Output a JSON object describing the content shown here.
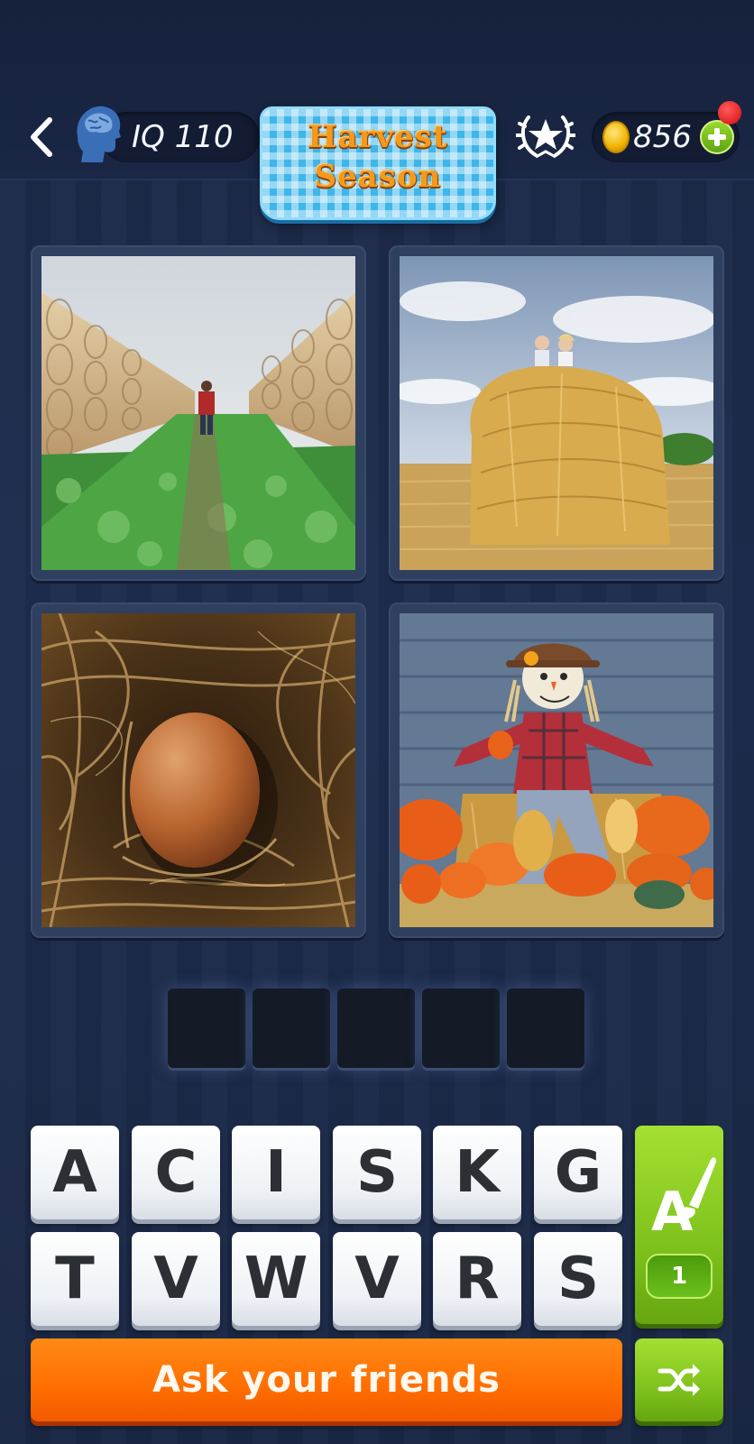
{
  "header": {
    "back_icon": "chevron-left-icon",
    "iq_icon": "brain-head-icon",
    "iq_label": "IQ 110",
    "banner_line1": "Harvest",
    "banner_line2": "Season",
    "achievements_icon": "laurel-star-icon",
    "coin_icon": "coin-icon",
    "coins": "856",
    "add_coins_icon": "plus-icon",
    "notification_indicator": "red-dot"
  },
  "puzzle": {
    "images": [
      {
        "subject": "hay bale rows in a field",
        "icon": "photo"
      },
      {
        "subject": "children on a hay bale",
        "icon": "photo"
      },
      {
        "subject": "egg in a straw nest",
        "icon": "photo"
      },
      {
        "subject": "scarecrow with pumpkins",
        "icon": "photo"
      }
    ],
    "answer_slots": [
      "",
      "",
      "",
      "",
      ""
    ]
  },
  "keyboard": {
    "row1": [
      "A",
      "C",
      "I",
      "S",
      "K",
      "G"
    ],
    "row2": [
      "T",
      "V",
      "W",
      "V",
      "R",
      "S"
    ]
  },
  "hint": {
    "icon": "letter-brush-icon",
    "count": "1"
  },
  "actions": {
    "ask_friends_label": "Ask your friends",
    "shuffle_icon": "shuffle-icon"
  },
  "colors": {
    "background": "#1c2a4a",
    "accent_green": "#7fc21c",
    "accent_orange": "#ff6d00",
    "banner_blue": "#3fb6ea"
  }
}
